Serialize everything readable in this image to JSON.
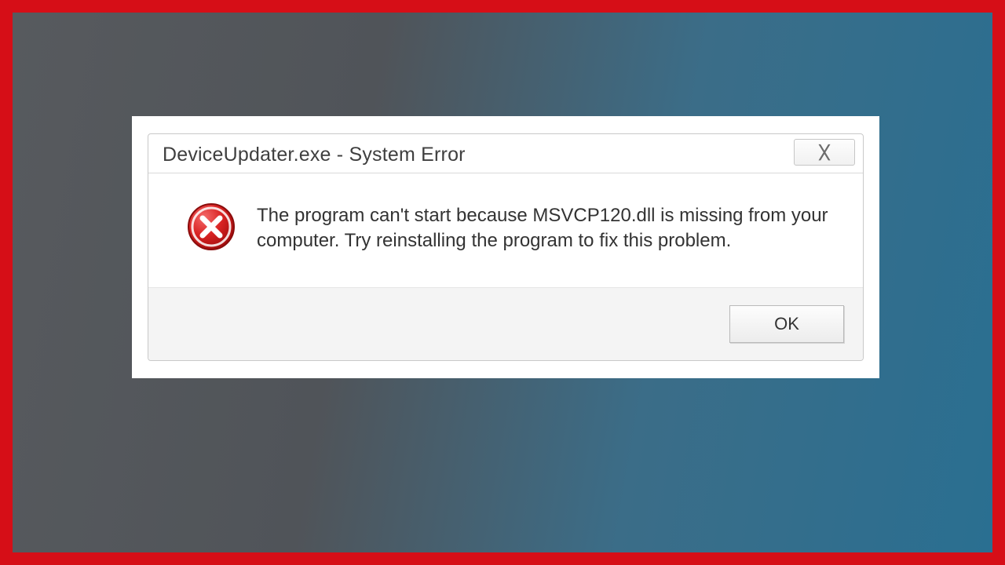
{
  "dialog": {
    "title": "DeviceUpdater.exe - System Error",
    "close_glyph": "╳",
    "message": "The program can't start because MSVCP120.dll is missing from your computer. Try reinstalling the program to fix this problem.",
    "ok_label": "OK"
  }
}
